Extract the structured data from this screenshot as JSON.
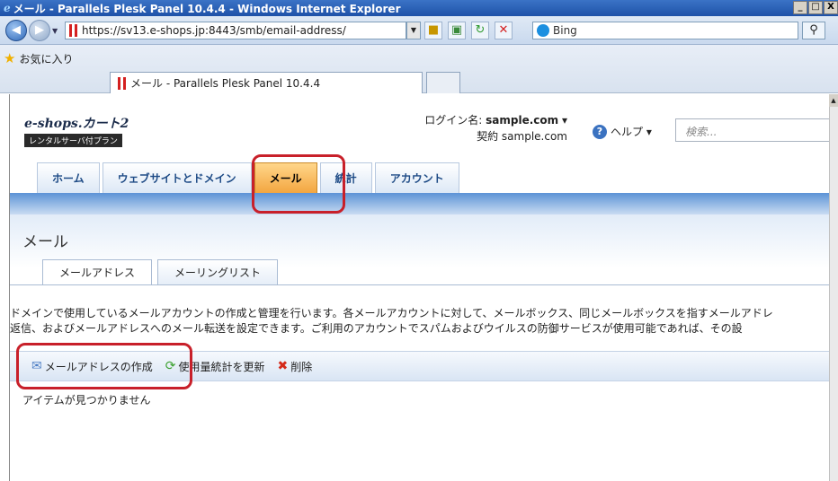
{
  "window": {
    "title": "メール - Parallels Plesk Panel 10.4.4 - Windows Internet Explorer",
    "minimize": "_",
    "maximize": "□",
    "close": "X"
  },
  "browser": {
    "url": "https://sv13.e-shops.jp:8443/smb/email-address/",
    "search_placeholder": "Bing",
    "favorites_label": "お気に入り",
    "tab_title": "メール - Parallels Plesk Panel 10.4.4"
  },
  "header": {
    "logo": "e-shops.カート2",
    "logo_sub": "レンタルサーバ付プラン",
    "login_label": "ログイン名:",
    "login_name": "sample.com",
    "contract_label": "契約",
    "contract_value": "sample.com",
    "help_label": "ヘルプ",
    "search_placeholder": "検索..."
  },
  "main_tabs": [
    {
      "label": "ホーム"
    },
    {
      "label": "ウェブサイトとドメイン"
    },
    {
      "label": "メール",
      "active": true
    },
    {
      "label": "統計"
    },
    {
      "label": "アカウント"
    }
  ],
  "page": {
    "title": "メール",
    "sub_tabs": [
      {
        "label": "メールアドレス",
        "active": true
      },
      {
        "label": "メーリングリスト"
      }
    ],
    "description_line1": "ドメインで使用しているメールアカウントの作成と管理を行います。各メールアカウントに対して、メールボックス、同じメールボックスを指すメールアドレ",
    "description_line2": "返信、およびメールアドレスへのメール転送を設定できます。ご利用のアカウントでスパムおよびウイルスの防御サービスが使用可能であれば、その設",
    "toolbar": {
      "create": "メールアドレスの作成",
      "refresh": "使用量統計を更新",
      "delete": "削除"
    },
    "empty_message": "アイテムが見つかりません"
  },
  "colors": {
    "highlight": "#c8202a",
    "active_tab": "#f3a640",
    "accent_blue": "#3b72c0"
  }
}
